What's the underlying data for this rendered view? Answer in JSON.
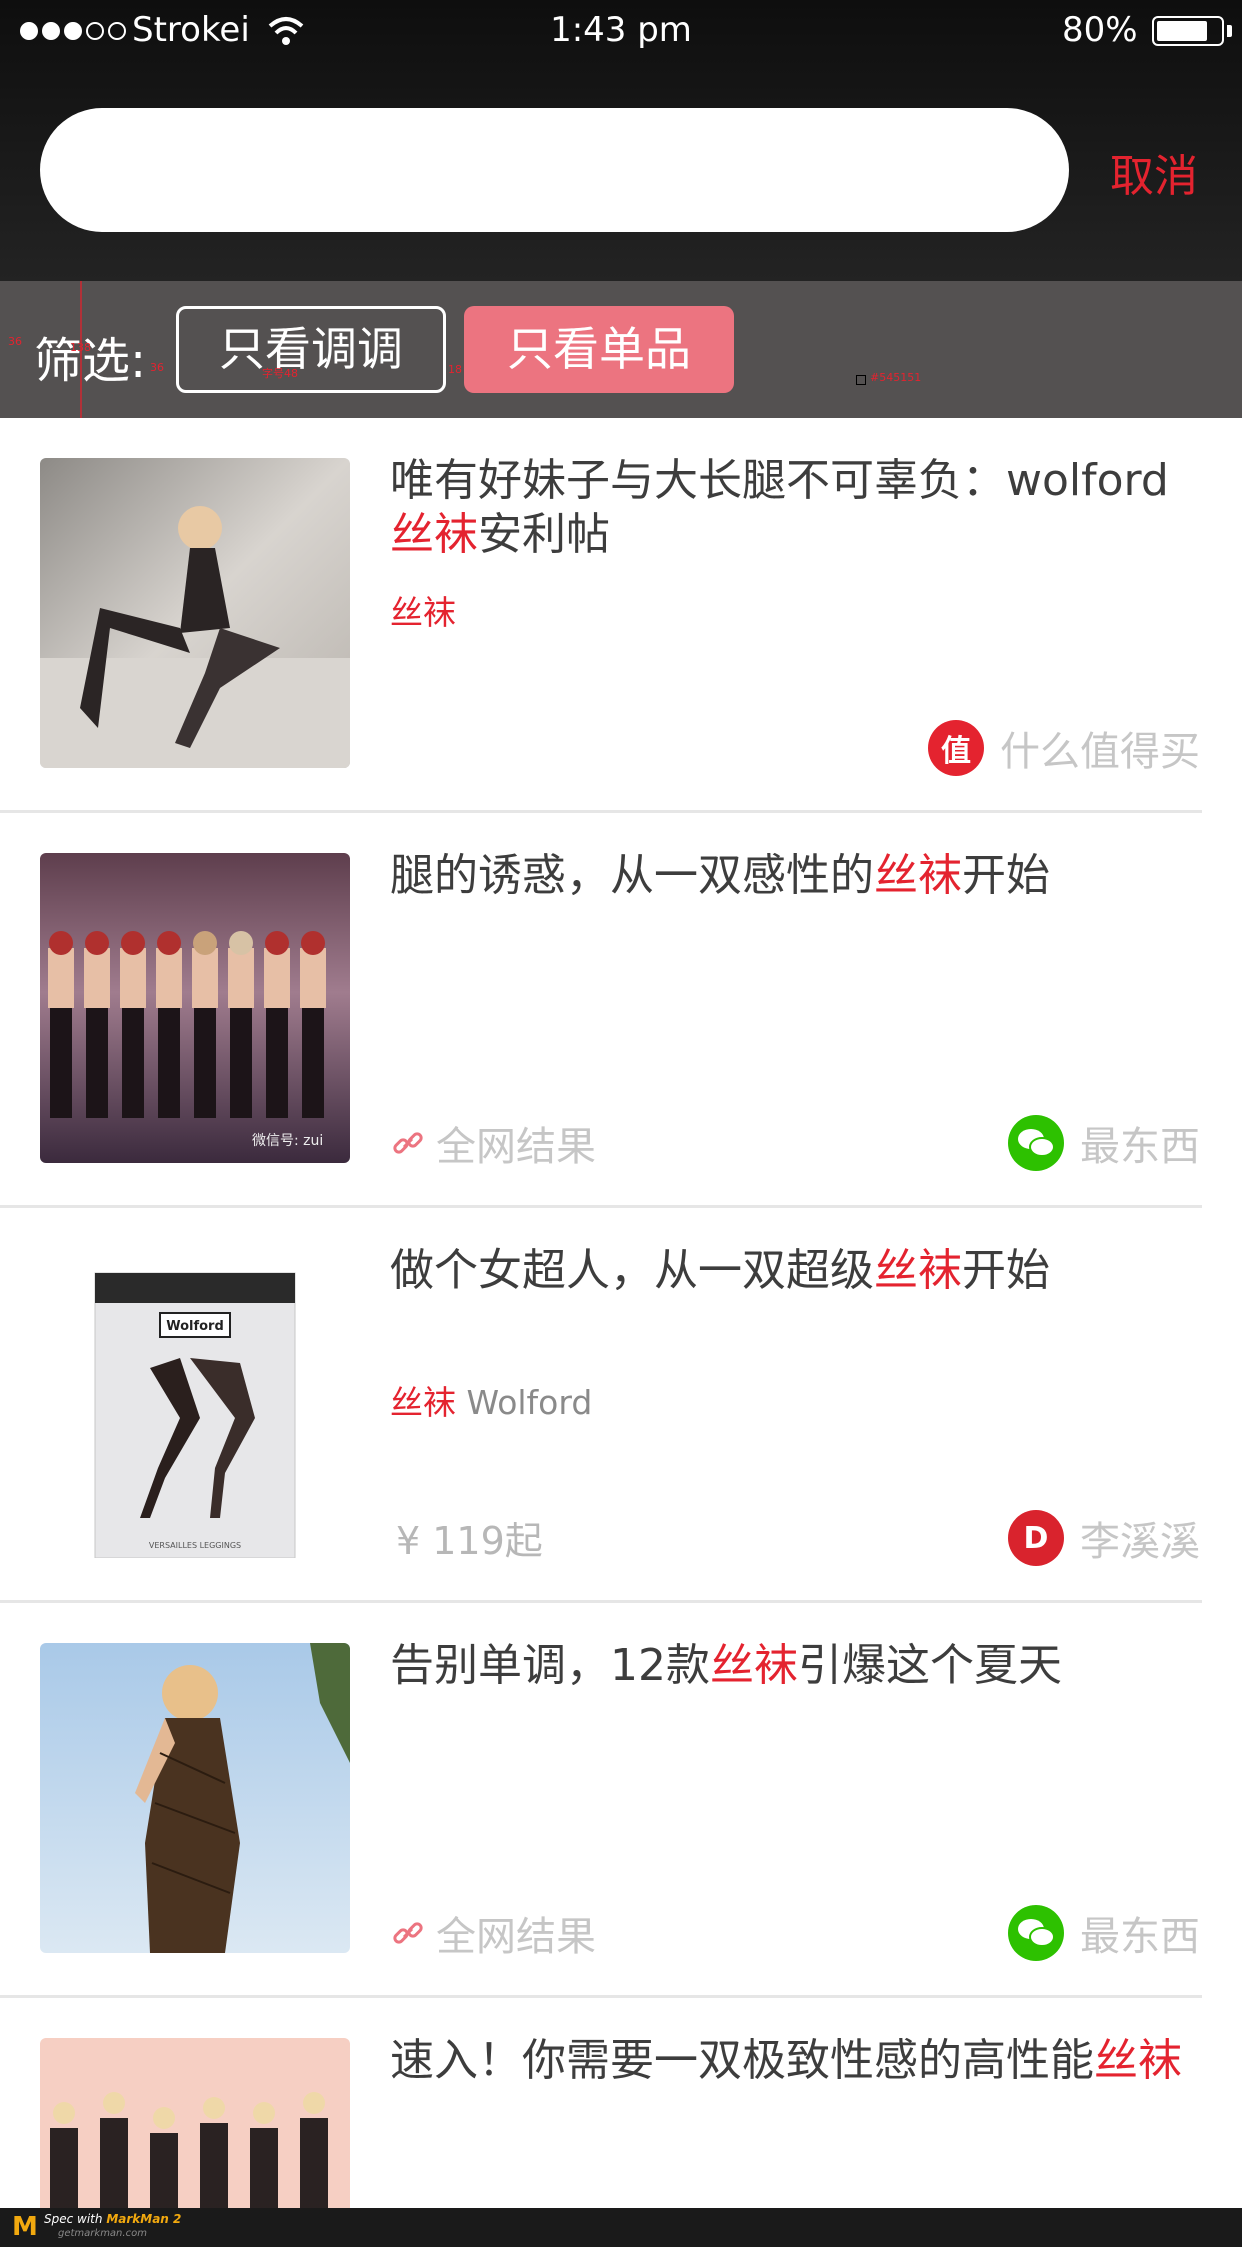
{
  "status_bar": {
    "carrier": "Strokei",
    "time": "1:43 pm",
    "battery": "80%",
    "signal_bars": 3,
    "signal_total": 5
  },
  "search": {
    "value": "",
    "placeholder": "",
    "cancel_label": "取消"
  },
  "filter": {
    "label": "筛选:",
    "options": [
      "只看调调",
      "只看单品"
    ],
    "active_index": 1
  },
  "spec_annotations": {
    "a": "36",
    "b": "138",
    "c": "36",
    "d": "字号48",
    "e": "18",
    "f": "#545151"
  },
  "results": [
    {
      "title_pre": "唯有好妹子与大长腿不可辜负：wolford",
      "title_hl": "丝袜",
      "title_post": "安利帖",
      "tag_hl": "丝袜",
      "tag_rest": "",
      "source": "什么值得买",
      "source_icon": "zhi-icon",
      "source_color": "#e4232f"
    },
    {
      "title_pre": "腿的诱惑，从一双感性的",
      "title_hl": "丝袜",
      "title_post": "开始",
      "allnet": "全网结果",
      "thumb_watermark": "微信号: zui",
      "source": "最东西",
      "source_icon": "wechat-icon",
      "source_color": "#2dc100"
    },
    {
      "title_pre": "做个女超人，从一双超级",
      "title_hl": "丝袜",
      "title_post": "开始",
      "tag_hl": "丝袜",
      "tag_rest": "Wolford",
      "price": "¥ 119起",
      "thumb_brand": "Wolford",
      "thumb_caption": "VERSAILLES LEGGINGS",
      "source": "李溪溪",
      "source_icon": "d-icon",
      "source_color": "#d9232d"
    },
    {
      "title_pre": "告别单调，12款",
      "title_hl": "丝袜",
      "title_post": "引爆这个夏天",
      "allnet": "全网结果",
      "source": "最东西",
      "source_icon": "wechat-icon",
      "source_color": "#2dc100"
    },
    {
      "title_pre": "速入！你需要一双极致性感的高性能",
      "title_hl": "丝袜",
      "title_post": ""
    }
  ],
  "footer": {
    "logo": "M",
    "line1_pre": "Spec with ",
    "line1_brand": "MarkMan 2",
    "line2": "getmarkman.com"
  },
  "colors": {
    "accent": "#e4232f",
    "filter_bar": "#545151",
    "active_pill": "#ec7480"
  }
}
